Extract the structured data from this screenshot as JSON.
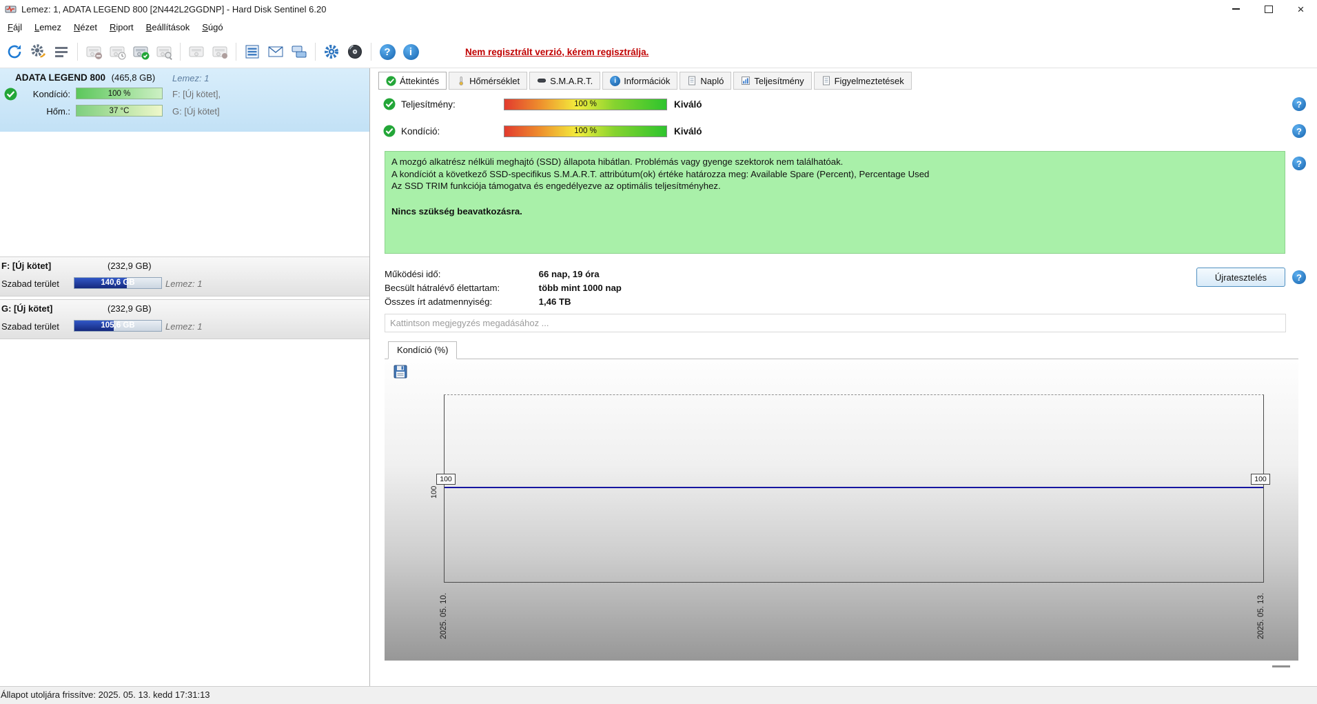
{
  "window": {
    "title": "Lemez: 1, ADATA LEGEND 800 [2N442L2GGDNP] - Hard Disk Sentinel 6.20"
  },
  "menu": {
    "items": [
      "Fájl",
      "Lemez",
      "Nézet",
      "Riport",
      "Beállítások",
      "Súgó"
    ]
  },
  "toolbar": {
    "register_link": "Nem regisztrált verzió, kérem regisztrálja.",
    "icons": [
      "refresh-icon",
      "analyse-gear-icon",
      "report-icon",
      "disk-silence-icon",
      "disk-clock-icon",
      "disk-test-icon",
      "disk-search-icon",
      "disk-offline-icon",
      "disk-surface-icon",
      "hardware-monitor-icon",
      "mail-icon",
      "network-disks-icon",
      "settings-gear-icon",
      "disc-icon",
      "help-icon",
      "information-icon"
    ]
  },
  "sidebar": {
    "disk": {
      "name": "ADATA LEGEND 800",
      "size": "(465,8 GB)",
      "disk_label": "Lemez: 1",
      "condition_label": "Kondíció:",
      "condition_value": "100 %",
      "temp_label": "Hőm.:",
      "temp_value": "37 °C",
      "volume1": "F: [Új kötet],",
      "volume2": "G: [Új kötet]"
    },
    "partitions": [
      {
        "name": "F: [Új kötet]",
        "size": "(232,9 GB)",
        "free_label": "Szabad terület",
        "free_value": "140,6 GB",
        "free_pct": 60,
        "disk": "Lemez: 1"
      },
      {
        "name": "G: [Új kötet]",
        "size": "(232,9 GB)",
        "free_label": "Szabad terület",
        "free_value": "105,6 GB",
        "free_pct": 45,
        "disk": "Lemez: 1"
      }
    ]
  },
  "tabs": [
    "Áttekintés",
    "Hőmérséklet",
    "S.M.A.R.T.",
    "Információk",
    "Napló",
    "Teljesítmény",
    "Figyelmeztetések"
  ],
  "overview": {
    "performance_label": "Teljesítmény:",
    "performance_value": "100 %",
    "performance_rating": "Kiváló",
    "condition_label": "Kondíció:",
    "condition_value": "100 %",
    "condition_rating": "Kiváló",
    "box_lines": [
      "A mozgó alkatrész nélküli meghajtó (SSD) állapota hibátlan. Problémás vagy gyenge szektorok nem találhatóak.",
      "A kondíciót a következő SSD-specifikus S.M.A.R.T. attribútum(ok) értéke határozza meg: Available Spare (Percent), Percentage Used",
      "Az SSD TRIM funkciója támogatva és engedélyezve az optimális teljesítményhez."
    ],
    "box_action": "Nincs szükség beavatkozásra.",
    "stats": [
      {
        "label": "Működési idő:",
        "value": "66 nap, 19 óra"
      },
      {
        "label": "Becsült hátralévő élettartam:",
        "value": "több mint 1000 nap"
      },
      {
        "label": "Összes írt adatmennyiség:",
        "value": "1,46 TB"
      }
    ],
    "retest_button": "Újratesztelés",
    "comment_placeholder": "Kattintson megjegyzés megadásához ..."
  },
  "chart": {
    "tab_label": "Kondíció (%)",
    "y_value_label": "100",
    "left_point_label": "100",
    "right_point_label": "100",
    "x_left": "2025. 05. 10.",
    "x_right": "2025. 05. 13.",
    "chart_data": {
      "type": "line",
      "title": "Kondíció (%)",
      "x": [
        "2025. 05. 10.",
        "2025. 05. 13."
      ],
      "values": [
        100,
        100
      ],
      "visible_axis_value_labels": [
        "100"
      ],
      "line_color": "#1515a0",
      "legend": "none"
    }
  },
  "statusbar": {
    "text": "Állapot utoljára frissítve: 2025. 05. 13. kedd 17:31:13"
  }
}
